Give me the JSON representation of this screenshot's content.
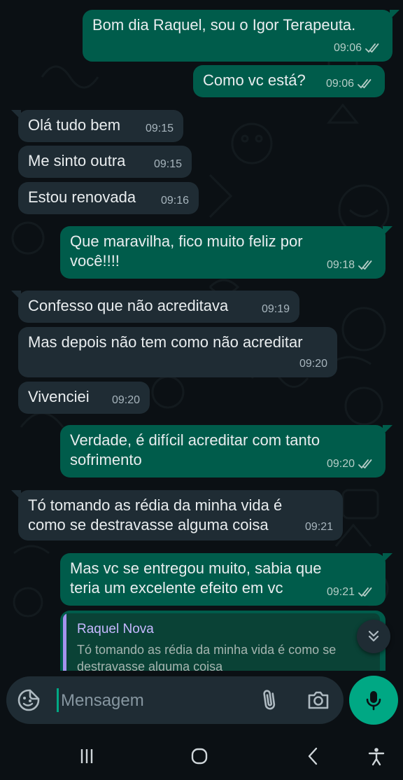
{
  "colors": {
    "incoming_bubble": "#1f2c34",
    "outgoing_bubble": "#005c4b",
    "accent": "#00a884",
    "read_ticks": "#b6cdc7",
    "quote_author": "#c6b8ff"
  },
  "messages": [
    {
      "dir": "out",
      "lines": [
        "Bom dia Raquel, sou o Igor Terapeuta."
      ],
      "time": "09:06",
      "status": "read"
    },
    {
      "dir": "out",
      "lines": [
        "Como vc está?"
      ],
      "time": "09:06",
      "status": "read"
    },
    {
      "dir": "in",
      "lines": [
        "Olá tudo bem"
      ],
      "time": "09:15"
    },
    {
      "dir": "in",
      "lines": [
        "Me sinto outra"
      ],
      "time": "09:15"
    },
    {
      "dir": "in",
      "lines": [
        "Estou renovada"
      ],
      "time": "09:16"
    },
    {
      "dir": "out",
      "lines": [
        "Que maravilha, fico muito feliz por",
        "você!!!!"
      ],
      "time": "09:18",
      "status": "read"
    },
    {
      "dir": "in",
      "lines": [
        "Confesso que não acreditava"
      ],
      "time": "09:19"
    },
    {
      "dir": "in",
      "lines": [
        "Mas depois não tem como não acreditar"
      ],
      "time": "09:20"
    },
    {
      "dir": "in",
      "lines": [
        "Vivenciei"
      ],
      "time": "09:20"
    },
    {
      "dir": "out",
      "lines": [
        "Verdade, é difícil acreditar com tanto",
        "sofrimento"
      ],
      "time": "09:20",
      "status": "read"
    },
    {
      "dir": "in",
      "lines": [
        "Tó tomando as rédia da minha vida é",
        "como se destravasse alguma coisa"
      ],
      "time": "09:21"
    },
    {
      "dir": "out",
      "lines": [
        "Mas vc se entregou muito, sabia que",
        "teria um excelente efeito em vc"
      ],
      "time": "09:21",
      "status": "read"
    }
  ],
  "quoted_reply": {
    "author": "Raquel Nova",
    "text": "Tó tomando as rédia da minha vida é como se destravasse alguma coisa"
  },
  "composer": {
    "placeholder": "Mensagem",
    "emoji_icon": "sticker-emoji-icon",
    "attach_icon": "paperclip-icon",
    "camera_icon": "camera-icon",
    "send_icon": "microphone-icon"
  },
  "scroll_button_icon": "double-chevron-down-icon",
  "navbar": {
    "recent_icon": "recent-apps-icon",
    "home_icon": "home-icon",
    "back_icon": "back-icon",
    "accessibility_icon": "accessibility-icon"
  }
}
